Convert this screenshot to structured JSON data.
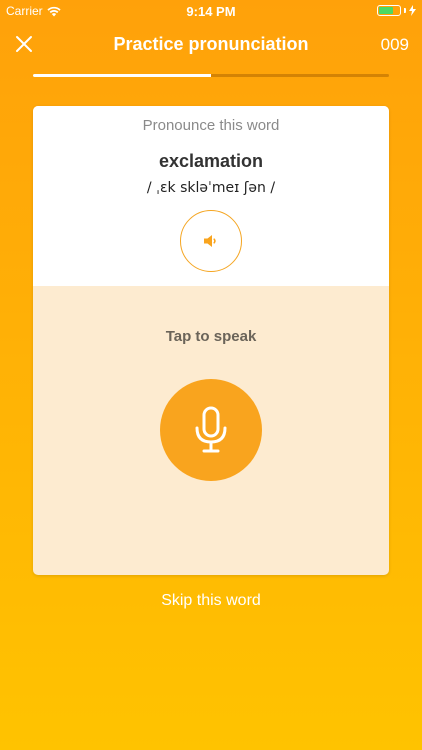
{
  "status_bar": {
    "carrier": "Carrier",
    "time": "9:14 PM",
    "wifi_icon": "wifi-icon",
    "battery_icon": "battery-icon",
    "charging_icon": "lightning-icon"
  },
  "header": {
    "title": "Practice pronunciation",
    "counter": "009",
    "close_icon": "close-icon"
  },
  "progress": {
    "fraction": 0.5
  },
  "card": {
    "prompt": "Pronounce this word",
    "word": "exclamation",
    "phonetic": "/ ˌɛk skləˈmeɪ ʃən /",
    "speaker_icon": "speaker-icon",
    "tap_label": "Tap to speak",
    "mic_icon": "microphone-icon"
  },
  "skip_label": "Skip this word",
  "colors": {
    "accent": "#F9A41E",
    "background_top": "#FFA10A",
    "background_bottom": "#FFC300",
    "speak_area": "#FDEBD0"
  }
}
